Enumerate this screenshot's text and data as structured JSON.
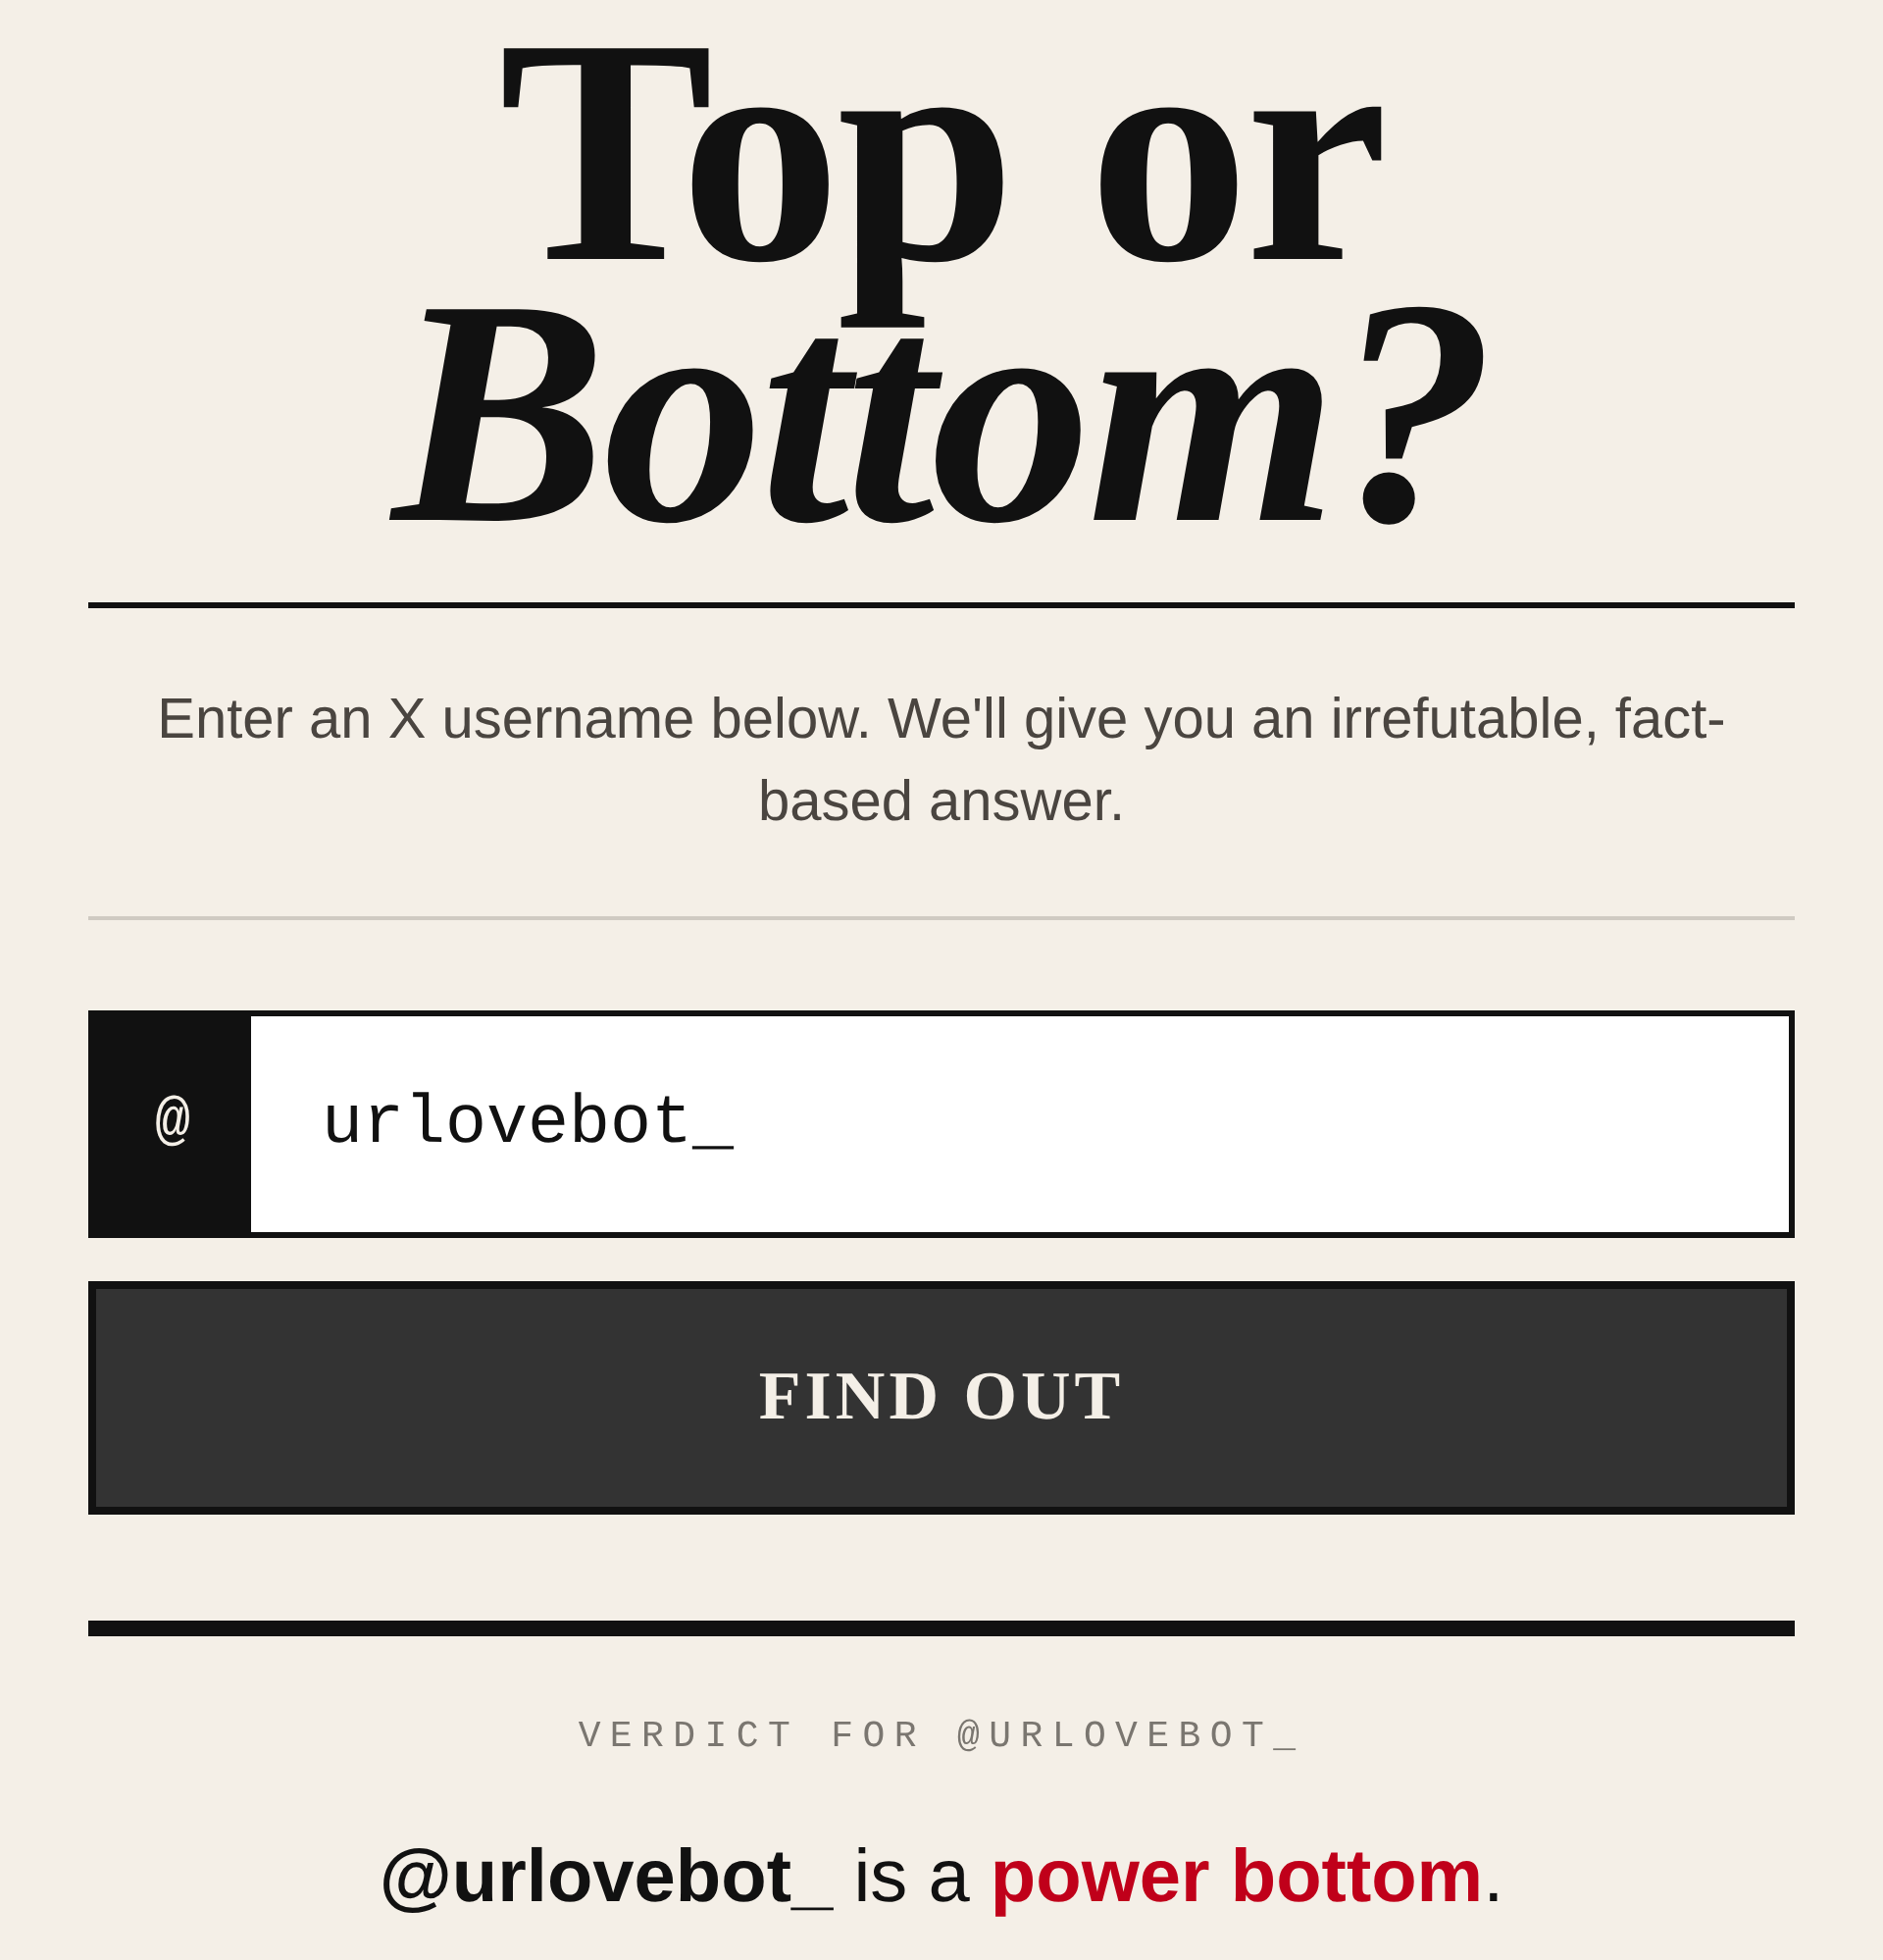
{
  "title": {
    "line_1": "Top or",
    "line_2": "Bottom?"
  },
  "intro": "Enter an X username below. We'll give you an irrefutable, fact-based answer.",
  "username_field": {
    "prefix": "@",
    "value": "urlovebot_"
  },
  "submit_button": {
    "label": "FIND OUT"
  },
  "result": {
    "heading": "VERDICT FOR @URLOVEBOT_",
    "subject": "@urlovebot_",
    "connector": "is a",
    "verdict": "power bottom",
    "end": "."
  }
}
